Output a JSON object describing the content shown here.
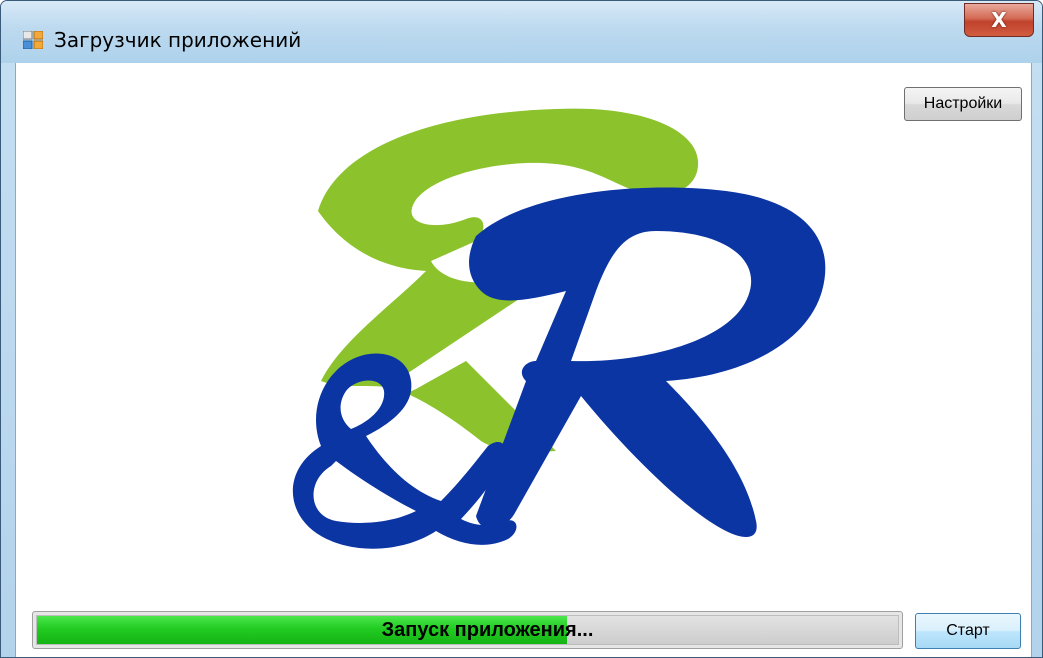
{
  "window": {
    "title": "Загрузчик приложений",
    "close_label": "X"
  },
  "toolbar": {
    "settings_label": "Настройки"
  },
  "logo": {
    "icon": "r-and-r-logo",
    "green": "#8cc22b",
    "blue": "#0b35a3"
  },
  "progress": {
    "text": "Запуск приложения...",
    "fraction": 0.615,
    "fill_color": "#22cc22"
  },
  "actions": {
    "start_label": "Старт"
  }
}
